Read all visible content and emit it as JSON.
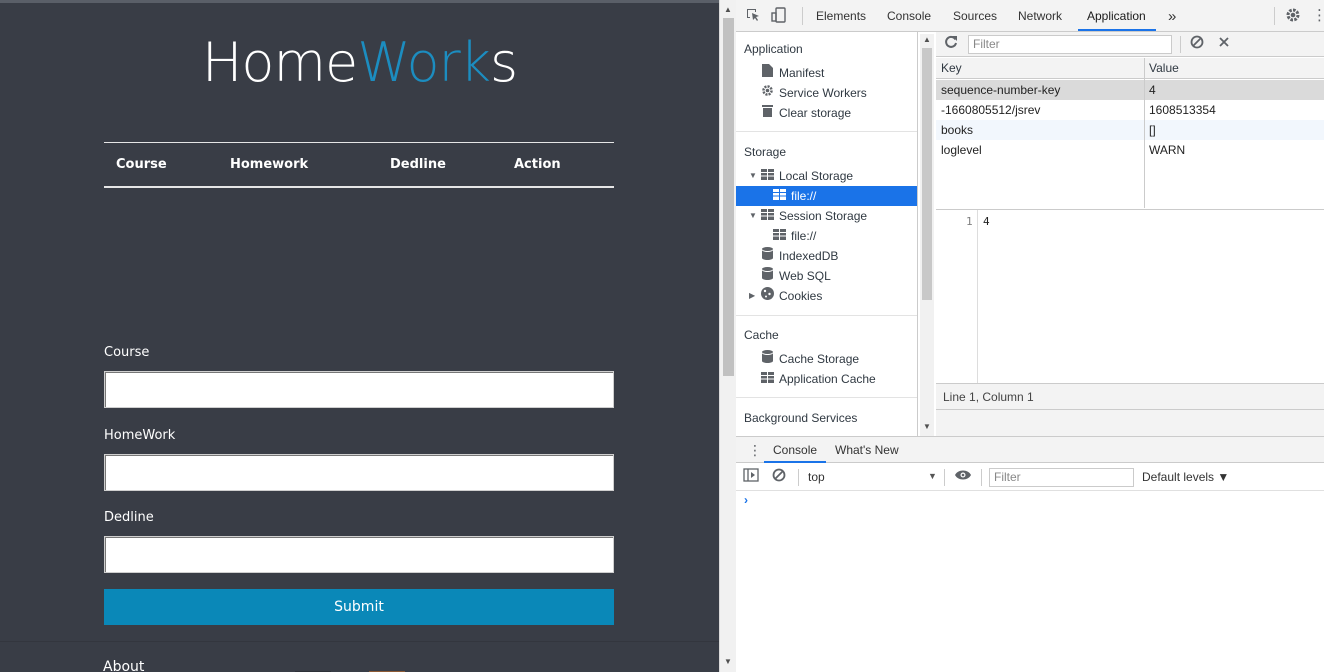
{
  "page": {
    "logo_part1": "Home",
    "logo_part2": "Work",
    "logo_part3": "s",
    "table_headers": [
      "Course",
      "Homework",
      "Dedline",
      "Action"
    ],
    "form": {
      "course_label": "Course",
      "homework_label": "HomeWork",
      "deadline_label": "Dedline",
      "submit_label": "Submit"
    },
    "footer_about": "About",
    "colors": {
      "background": "#393d46",
      "accent": "#1c8dc0",
      "button": "#0a88b8"
    }
  },
  "devtools": {
    "tabs": [
      "Elements",
      "Console",
      "Sources",
      "Network",
      "Application"
    ],
    "active_tab": "Application",
    "more_tabs": "»",
    "sidebar": {
      "application_title": "Application",
      "application_items": [
        "Manifest",
        "Service Workers",
        "Clear storage"
      ],
      "storage_title": "Storage",
      "local_storage": "Local Storage",
      "local_storage_child": "file://",
      "session_storage": "Session Storage",
      "session_storage_child": "file://",
      "indexeddb": "IndexedDB",
      "websql": "Web SQL",
      "cookies": "Cookies",
      "cache_title": "Cache",
      "cache_items": [
        "Cache Storage",
        "Application Cache"
      ],
      "background_title": "Background Services"
    },
    "filter_placeholder": "Filter",
    "grid": {
      "headers": [
        "Key",
        "Value"
      ],
      "rows": [
        {
          "key": "sequence-number-key",
          "value": "4"
        },
        {
          "key": "-1660805512/jsrev",
          "value": "1608513354"
        },
        {
          "key": "books",
          "value": "[]"
        },
        {
          "key": "loglevel",
          "value": "WARN"
        }
      ]
    },
    "editor": {
      "line_number": "1",
      "content": "4"
    },
    "status": "Line 1, Column 1",
    "drawer": {
      "tabs": [
        "Console",
        "What's New"
      ],
      "context": "top",
      "filter_placeholder": "Filter",
      "levels": "Default levels ▼",
      "prompt": "›"
    }
  }
}
